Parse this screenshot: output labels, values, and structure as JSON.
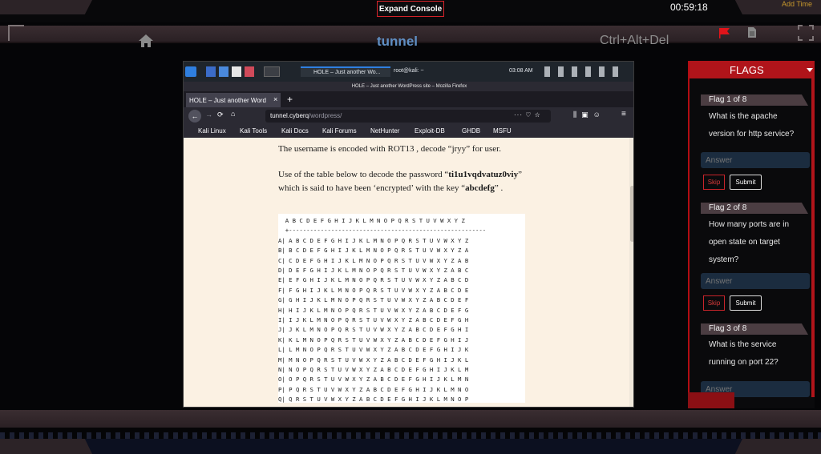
{
  "top": {
    "expand_console": "Expand Console",
    "timer": "00:59:18",
    "add_time": "Add Time",
    "title": "tunnel",
    "ctrl_alt_del": "Ctrl+Alt+Del"
  },
  "kali": {
    "task_firefox": "HOLE – Just another Wo...",
    "task_terminal": "root@kali: ~",
    "clock": "03:08 AM"
  },
  "firefox": {
    "window_title": "HOLE – Just another WordPress site – Mozilla Firefox",
    "tab_label": "HOLE – Just another Word",
    "url_domain": "tunnel.cyberq",
    "url_path": "/wordpress/",
    "bookmarks": [
      "Kali Linux",
      "Kali Tools",
      "Kali Docs",
      "Kali Forums",
      "NetHunter",
      "Exploit-DB",
      "GHDB",
      "MSFU"
    ]
  },
  "content": {
    "line1": "The username is encoded with ROT13 , decode “jryy” for user.",
    "line2_a": "Use of the table below to decode the password “",
    "password": "ti1u1vqdvatuz0viy",
    "line2_b": "”",
    "line3_a": "which is said to have been ‘encrypted’ with the key “",
    "key": "abcdefg",
    "line3_b": "” ."
  },
  "vigenere": {
    "header": "  A B C D E F G H I J K L M N O P Q R S T U V W X Y Z",
    "divider": "  +--------------------------------------------------------",
    "rows": [
      "A| A B C D E F G H I J K L M N O P Q R S T U V W X Y Z",
      "B| B C D E F G H I J K L M N O P Q R S T U V W X Y Z A",
      "C| C D E F G H I J K L M N O P Q R S T U V W X Y Z A B",
      "D| D E F G H I J K L M N O P Q R S T U V W X Y Z A B C",
      "E| E F G H I J K L M N O P Q R S T U V W X Y Z A B C D",
      "F| F G H I J K L M N O P Q R S T U V W X Y Z A B C D E",
      "G| G H I J K L M N O P Q R S T U V W X Y Z A B C D E F",
      "H| H I J K L M N O P Q R S T U V W X Y Z A B C D E F G",
      "I| I J K L M N O P Q R S T U V W X Y Z A B C D E F G H",
      "J| J K L M N O P Q R S T U V W X Y Z A B C D E F G H I",
      "K| K L M N O P Q R S T U V W X Y Z A B C D E F G H I J",
      "L| L M N O P Q R S T U V W X Y Z A B C D E F G H I J K",
      "M| M N O P Q R S T U V W X Y Z A B C D E F G H I J K L",
      "N| N O P Q R S T U V W X Y Z A B C D E F G H I J K L M",
      "O| O P Q R S T U V W X Y Z A B C D E F G H I J K L M N",
      "P| P Q R S T U V W X Y Z A B C D E F G H I J K L M N O",
      "Q| Q R S T U V W X Y Z A B C D E F G H I J K L M N O P",
      "R| R S T U V W X Y Z A B C D E F G H I J K L M N O P Q"
    ]
  },
  "sidebar": {
    "title": "FLAGS",
    "flags": [
      {
        "label": "Flag 1 of 8",
        "q1": "What is the apache",
        "q2": "version for http service?",
        "q3": "",
        "answer_placeholder": "Answer",
        "skip": "Skip",
        "submit": "Submit"
      },
      {
        "label": "Flag 2 of 8",
        "q1": "How many ports are in",
        "q2": "open state on target",
        "q3": "system?",
        "answer_placeholder": "Answer",
        "skip": "Skip",
        "submit": "Submit"
      },
      {
        "label": "Flag 3 of 8",
        "q1": "What is the service",
        "q2": "running on port 22?",
        "q3": "",
        "answer_placeholder": "Answer"
      }
    ]
  }
}
